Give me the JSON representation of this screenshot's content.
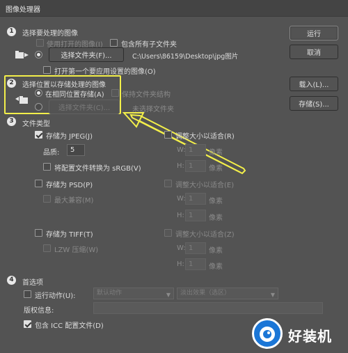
{
  "window": {
    "title": "图像处理器"
  },
  "sections": {
    "s1": {
      "number": "1",
      "title": "选择要处理的图像",
      "use_open_images": "使用打开的图像(I)",
      "include_subfolders": "包含所有子文件夹",
      "select_folder_button": "选择文件夹(F)...",
      "folder_path": "C:\\Users\\86159\\Desktop\\jpg图片",
      "open_first_image": "打开第一个要应用设置的图像(O)"
    },
    "s2": {
      "number": "2",
      "title": "选择位置以存储处理的图像",
      "save_same_location": "在相同位置存储(A)",
      "keep_structure": "保持文件夹结构",
      "select_folder_button": "选择文件夹(C)...",
      "no_folder": "未选择文件夹"
    },
    "s3": {
      "number": "3",
      "title": "文件类型",
      "jpeg": {
        "save_as": "存储为 JPEG(J)",
        "resize": "调整大小以适合(R)",
        "quality_label": "品质:",
        "quality_value": "5",
        "w_label": "W:",
        "w_value": "1",
        "h_label": "H:",
        "h_value": "1",
        "px": "像素",
        "convert_srgb": "将配置文件转换为 sRGB(V)"
      },
      "psd": {
        "save_as": "存储为 PSD(P)",
        "resize": "调整大小以适合(E)",
        "max_compat": "最大兼容(M)",
        "w_label": "W:",
        "w_value": "1",
        "h_label": "H:",
        "h_value": "1",
        "px": "像素"
      },
      "tiff": {
        "save_as": "存储为 TIFF(T)",
        "resize": "调整大小以适合(Z)",
        "lzw": "LZW 压缩(W)",
        "w_label": "W:",
        "w_value": "1",
        "h_label": "H:",
        "h_value": "1",
        "px": "像素"
      }
    },
    "s4": {
      "number": "4",
      "title": "首选项",
      "run_action": "运行动作(U):",
      "action_set": "默认动作",
      "action_name": "淡出效果（选区）",
      "copyright_label": "版权信息:",
      "copyright_value": "",
      "include_icc": "包含 ICC 配置文件(D)"
    }
  },
  "buttons": {
    "run": "运行",
    "cancel": "取消",
    "load": "载入(L)...",
    "save": "存储(S)..."
  },
  "watermark": {
    "text": "好装机"
  },
  "colors": {
    "highlight": "#f3ef4a",
    "dialog_bg": "#535353",
    "watermark_blue": "#1b76d6"
  }
}
